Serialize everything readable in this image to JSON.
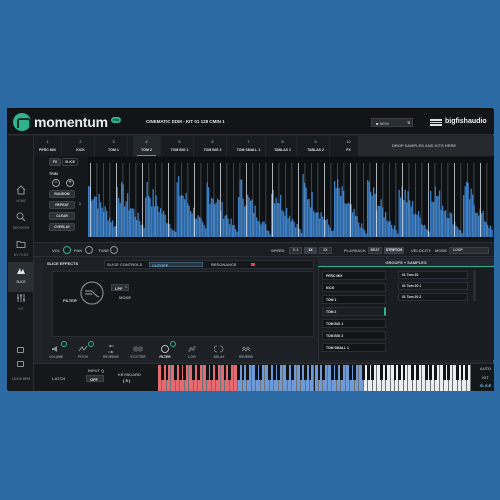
{
  "app": {
    "name": "momentum",
    "badge": "PRO",
    "kit_title": "CINEMATIC EDM - KIT 01 128 CMIN 1",
    "preset": "■ NEW",
    "publisher": "bigfishaudio"
  },
  "slots": [
    {
      "num": "1",
      "label": "PERC MIX"
    },
    {
      "num": "2",
      "label": "KICK"
    },
    {
      "num": "3",
      "label": "TOM 1"
    },
    {
      "num": "4",
      "label": "TOM 2"
    },
    {
      "num": "5",
      "label": "TOM BIG 1"
    },
    {
      "num": "6",
      "label": "TOM BIG 2"
    },
    {
      "num": "7",
      "label": "TOM SMALL 1"
    },
    {
      "num": "8",
      "label": "TABLAS 1"
    },
    {
      "num": "9",
      "label": "TABLAS 2"
    },
    {
      "num": "10",
      "label": "FX"
    }
  ],
  "drop_text": "DROP SAMPLES AND KITS HERE",
  "sidebar": [
    {
      "label": "HOME",
      "icon": "home-icon"
    },
    {
      "label": "BROWSER",
      "icon": "search-icon"
    },
    {
      "label": "MY FILES",
      "icon": "folder-icon"
    },
    {
      "label": "SLICE",
      "icon": "slice-icon"
    },
    {
      "label": "KIT",
      "icon": "kit-icon"
    }
  ],
  "sidebar_bottom": {
    "bpm": "120.00 BPM"
  },
  "wave_controls": {
    "tab_fx": "FX",
    "tab_slice": "SLICE",
    "trim": "TRIM",
    "minus": "−",
    "plus": "+",
    "random": "RANDOM",
    "repeat": "REPEAT",
    "repeat_val": "1",
    "clear": "CLEAR",
    "overlay": "OVERLAY"
  },
  "param_bar": {
    "vol": "VOL",
    "pan": "PAN",
    "tune": "TUNE",
    "speed": "SPEED",
    "speeds": [
      "½ 1",
      "1X",
      "2X"
    ],
    "playback": "PLAYBACK",
    "beat": "BEAT",
    "stretch": "STRETCH",
    "velocity": "VELOCITY",
    "mode": "MODE",
    "loop": "LOOP"
  },
  "slice_effects": {
    "title": "SLICE EFFECTS",
    "slice_controls": "SLICE CONTROLS",
    "cutoff": "CUTOFF",
    "resonance": "RESONANCE",
    "filter_label": "FILTER",
    "lpf": "LPF",
    "mode": "MODE"
  },
  "fx_selectors": [
    "VOLUME",
    "PITCH",
    "REVERSE",
    "STUTTER",
    "FILTER",
    "LOFI",
    "DELAY",
    "REVERB"
  ],
  "groups": {
    "title": "GROUPS + SAMPLES",
    "items": [
      "PERC MIX",
      "KICK",
      "TOM 1",
      "TOM 2",
      "TOM BIG 1",
      "TOM BIG 2",
      "TOM SMALL 1"
    ],
    "samples": [
      "01 Tom 20",
      "01 Tom 20 1",
      "01 Tom 20 2"
    ]
  },
  "keyboard": {
    "latch": "LATCH",
    "input_q": "INPUT Q",
    "input_val": "OFF",
    "keyboard": "KEYBOARD",
    "kb_val": "( 5 )",
    "auto": "AUTO",
    "kit": "KIT",
    "slice": "SLICE"
  },
  "colors": {
    "accent": "#2fb38f",
    "wave": "#3a7fc6",
    "background": "#2b6aa3",
    "red_keys": "#e46b70",
    "blue_keys": "#6f9ad8"
  }
}
